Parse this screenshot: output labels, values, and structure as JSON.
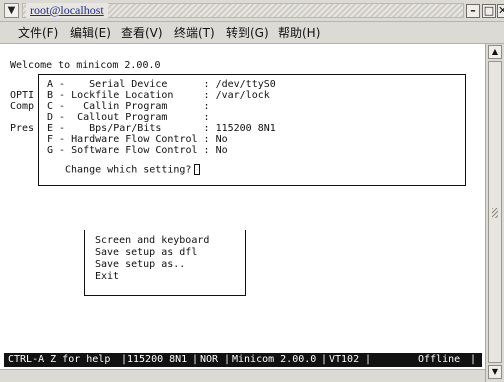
{
  "window": {
    "title": "root@localhost",
    "controls": {
      "minimize": "–",
      "maximize": "□",
      "close": "✕"
    }
  },
  "menubar": {
    "items": [
      {
        "label": "文件(F)"
      },
      {
        "label": "编辑(E)"
      },
      {
        "label": "查看(V)"
      },
      {
        "label": "终端(T)"
      },
      {
        "label": "转到(G)"
      },
      {
        "label": "帮助(H)"
      }
    ]
  },
  "terminal": {
    "welcome": "Welcome to minicom 2.00.0",
    "side_lines": [
      "OPTI",
      "Comp",
      "Pres"
    ],
    "settings_dialog": {
      "rows": [
        "A -    Serial Device      : /dev/ttyS0",
        "B - Lockfile Location     : /var/lock",
        "C -   Callin Program      :",
        "D -  Callout Program      :",
        "E -    Bps/Par/Bits       : 115200 8N1",
        "F - Hardware Flow Control : No",
        "G - Software Flow Control : No"
      ],
      "prompt": "Change which setting?"
    },
    "submenu": {
      "items": [
        "Screen and keyboard",
        "Save setup as dfl",
        "Save setup as..",
        "Exit"
      ]
    },
    "statusbar": {
      "help": "CTRL-A Z for help",
      "baud": "115200 8N1",
      "mode": "NOR",
      "version": "Minicom 2.00.0",
      "terminal_type": "VT102",
      "state": "Offline"
    }
  },
  "scrollbar": {
    "up_arrow": "▲",
    "down_arrow": "▼"
  }
}
